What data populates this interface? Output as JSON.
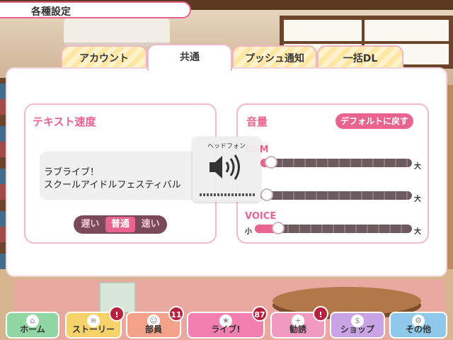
{
  "header": {
    "title": "各種設定"
  },
  "tabs": [
    {
      "label": "アカウント"
    },
    {
      "label": "共通"
    },
    {
      "label": "プッシュ通知"
    },
    {
      "label": "一括DL"
    }
  ],
  "text_speed": {
    "title": "テキスト速度",
    "sample_line1": "ラブライブ！",
    "sample_line2": "スクールアイドルフェスティバル",
    "options": [
      "遅い",
      "普通",
      "速い"
    ],
    "selected": "普通"
  },
  "volume": {
    "title": "音量",
    "default_button": "デフォルトに戻す",
    "sliders": [
      {
        "label": "BGM",
        "min_label": "",
        "max_label": "大",
        "value": 0.03
      },
      {
        "label": "",
        "min_label": "",
        "max_label": "大",
        "value": 0.0
      },
      {
        "label": "VOICE",
        "min_label": "小",
        "max_label": "大",
        "value": 0.12
      }
    ]
  },
  "headphone_overlay": {
    "label": "ヘッドフォン",
    "icon": "speaker-icon"
  },
  "nav": [
    {
      "label": "ホーム",
      "icon": "home-icon",
      "color": "#8fd6a2",
      "badge": ""
    },
    {
      "label": "ストーリー",
      "icon": "story-icon",
      "color": "#f5d26a",
      "badge": "!"
    },
    {
      "label": "部員",
      "icon": "members-icon",
      "color": "#f4a28a",
      "badge": "11"
    },
    {
      "label": "ライブ!",
      "icon": "live-icon",
      "color": "#f27fb0",
      "badge": "87"
    },
    {
      "label": "勧誘",
      "icon": "scout-icon",
      "color": "#f19ac0",
      "badge": "!"
    },
    {
      "label": "ショップ",
      "icon": "shop-icon",
      "color": "#c9a3e6",
      "badge": ""
    },
    {
      "label": "その他",
      "icon": "other-icon",
      "color": "#8ec8ea",
      "badge": ""
    }
  ],
  "colors": {
    "accent": "#e8648e",
    "tab_stripe": "#ffe7a3"
  }
}
